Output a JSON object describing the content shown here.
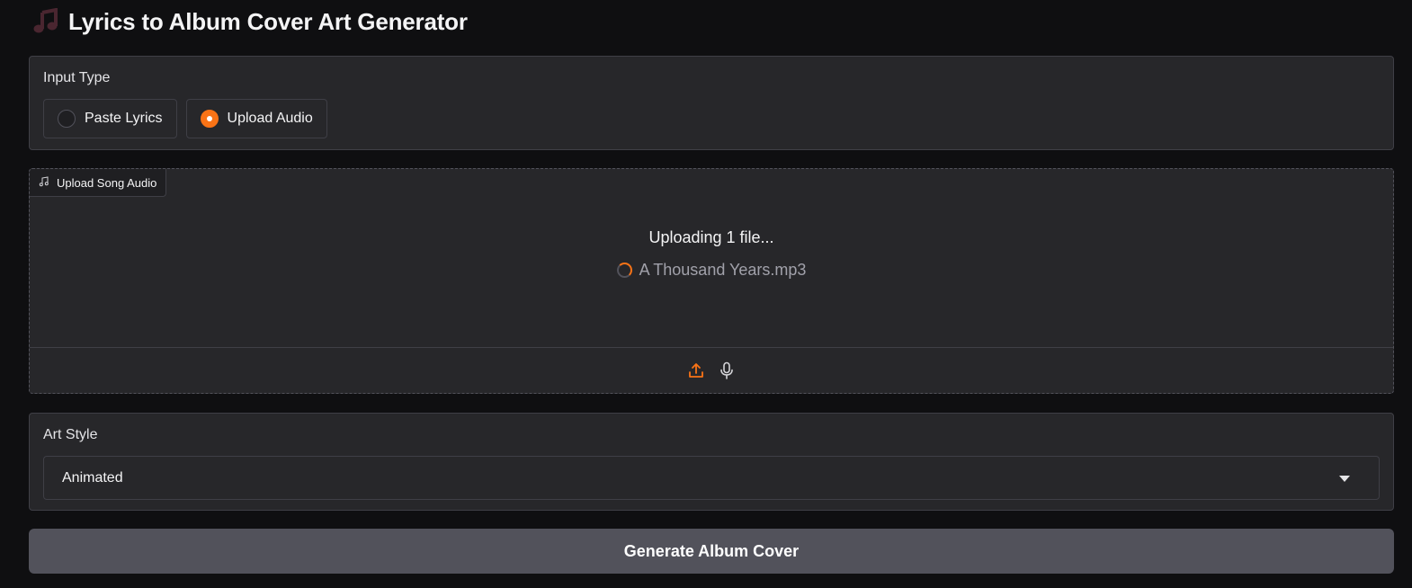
{
  "header": {
    "title": "Lyrics to Album Cover Art Generator",
    "icon": "musical-note-icon"
  },
  "input_type": {
    "label": "Input Type",
    "options": [
      {
        "label": "Paste Lyrics",
        "selected": false
      },
      {
        "label": "Upload Audio",
        "selected": true
      }
    ]
  },
  "upload": {
    "tag_label": "Upload Song Audio",
    "tag_icon": "music-icon",
    "status_text": "Uploading 1 file...",
    "file_name": "A Thousand Years.mp3",
    "toolbar": {
      "upload_icon": "upload-icon",
      "mic_icon": "microphone-icon"
    }
  },
  "art_style": {
    "label": "Art Style",
    "selected": "Animated"
  },
  "generate_button": {
    "label": "Generate Album Cover"
  },
  "colors": {
    "background": "#0f0f11",
    "panel": "#27272a",
    "accent": "#f97316",
    "button": "#52525b"
  }
}
